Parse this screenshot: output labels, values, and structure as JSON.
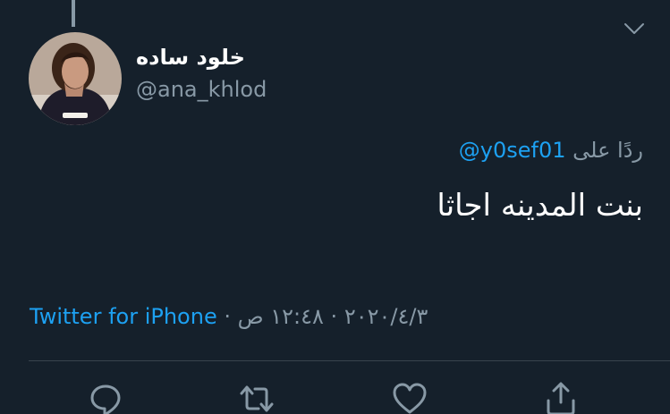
{
  "tweet": {
    "author": {
      "display_name": "خلود ساده",
      "handle": "@ana_khlod"
    },
    "reply_prefix": "ردًا على",
    "reply_to": "@y0sef01",
    "text": "بنت المدينه اجاثا",
    "source": "Twitter for iPhone",
    "separator": " · ",
    "timestamp": "٢٠٢٠/٤/٣ · ١٢:٤٨ ص"
  },
  "icons": {
    "caret": "chevron-down-icon",
    "reply": "reply-icon",
    "retweet": "retweet-icon",
    "like": "heart-icon",
    "share": "share-icon"
  },
  "colors": {
    "background": "#15202b",
    "primary_text": "#ffffff",
    "secondary_text": "#8899a6",
    "accent": "#1da1f2",
    "divider": "#38444d"
  }
}
